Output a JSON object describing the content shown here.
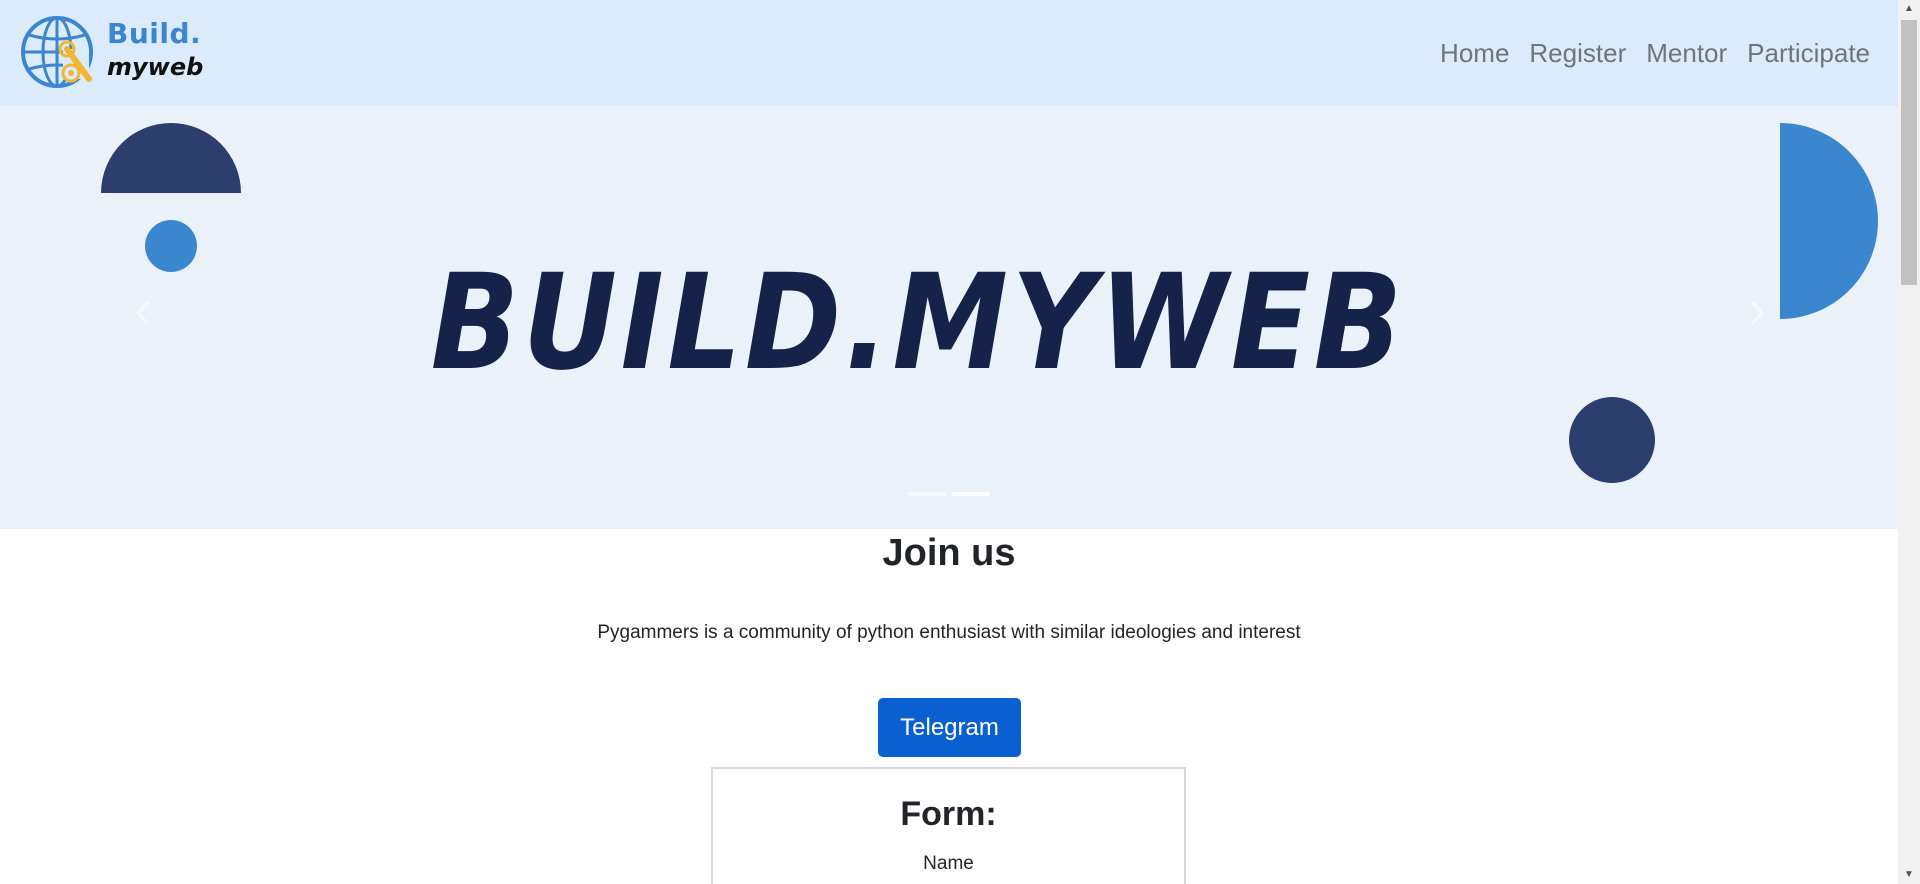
{
  "logo": {
    "line1": "Build.",
    "line2": "myweb",
    "icon": "globe-wrench-icon"
  },
  "nav": {
    "items": [
      {
        "label": "Home"
      },
      {
        "label": "Register"
      },
      {
        "label": "Mentor"
      },
      {
        "label": "Participate"
      }
    ]
  },
  "carousel": {
    "banner_text": "BUILD.MYWEB",
    "prev_icon": "chevron-left-icon",
    "next_icon": "chevron-right-icon",
    "slide_count": 2,
    "active_slide": 2
  },
  "join": {
    "title": "Join us",
    "description": "Pygammers is a community of python enthusiast with similar ideologies and interest",
    "button_label": "Telegram"
  },
  "form": {
    "title": "Form:",
    "name_label": "Name"
  },
  "colors": {
    "navbar_bg": "#dcebfb",
    "banner_bg": "#eaf1f8",
    "brand_blue": "#3a86cf",
    "navy": "#2c3e6e",
    "button_blue": "#0a5fd1"
  }
}
